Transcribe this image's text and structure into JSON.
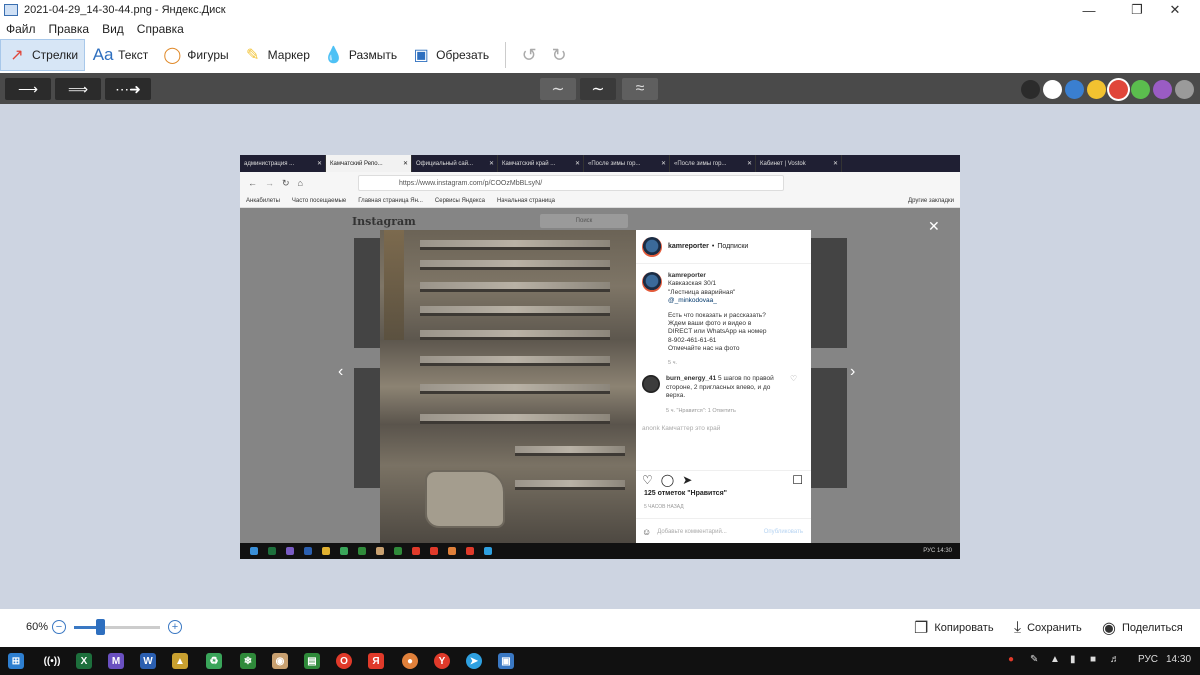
{
  "window": {
    "title": "2021-04-29_14-30-44.png - Яндекс.Диск"
  },
  "menu": [
    "Файл",
    "Правка",
    "Вид",
    "Справка"
  ],
  "toolbar": {
    "tools": [
      {
        "label": "Стрелки",
        "icon": "arrow-tool-icon",
        "active": true
      },
      {
        "label": "Текст",
        "icon": "text-tool-icon",
        "active": false
      },
      {
        "label": "Фигуры",
        "icon": "shapes-tool-icon",
        "active": false
      },
      {
        "label": "Маркер",
        "icon": "marker-tool-icon",
        "active": false
      },
      {
        "label": "Размыть",
        "icon": "blur-tool-icon",
        "active": false
      },
      {
        "label": "Обрезать",
        "icon": "crop-tool-icon",
        "active": false
      }
    ]
  },
  "colors": [
    "#2b2b2b",
    "#ffffff",
    "#3a7fd0",
    "#f2c230",
    "#e0463a",
    "#5bbd4e",
    "#9a5cc4",
    "#9a9a9a"
  ],
  "selected_color": "#e0463a",
  "browser": {
    "tabs": [
      "администрация ...",
      "Камчатский Репо...",
      "Официальный сай...",
      "Камчатский край ...",
      "«После зимы гор...",
      "«После зимы гор...",
      "Кабинет | Vostok"
    ],
    "url": "https://www.instagram.com/p/COOzMbBLsyN/",
    "bookmarks": [
      "Анкабилеты",
      "Часто посещаемые",
      "Главная страница Ян...",
      "Сервисы Яндекса",
      "Начальная страница"
    ],
    "bookmarks_right": "Другие закладки"
  },
  "instagram": {
    "logo": "Instagram",
    "search": "Поиск",
    "author": "kamreporter",
    "follow": "Подписки",
    "caption_lines": [
      "Кавказская 30/1",
      "\"Лестница аварийная\"",
      "@_minkodovaa_",
      "",
      "Есть что показать и рассказать?",
      "Ждем ваши фото и видео в",
      "DIRECT или WhatsApp на номер",
      "8-902-461-61-61",
      "Отмечайте нас на фото"
    ],
    "caption_ago": "5 ч.",
    "comment_user": "burn_energy_41",
    "comment_text": "5 шагов по правой стороне, 2 пригласных влево, и до верха.",
    "comment_meta": "5 ч.   \"Нравится\": 1   Ответить",
    "comment2": "anonk Камчаттер это край",
    "likes": "125 отметок \"Нравится\"",
    "date": "5 ЧАСОВ НАЗАД",
    "add_comment": "Добавьте комментарий...",
    "publish": "Опубликовать"
  },
  "inner_taskbar_right": "РУС  14:30",
  "zoom": {
    "label": "60%",
    "value": 0.3
  },
  "bottom_actions": [
    "Копировать",
    "Сохранить",
    "Поделиться"
  ],
  "taskbar": {
    "lang": "РУС",
    "time": "14:30"
  }
}
